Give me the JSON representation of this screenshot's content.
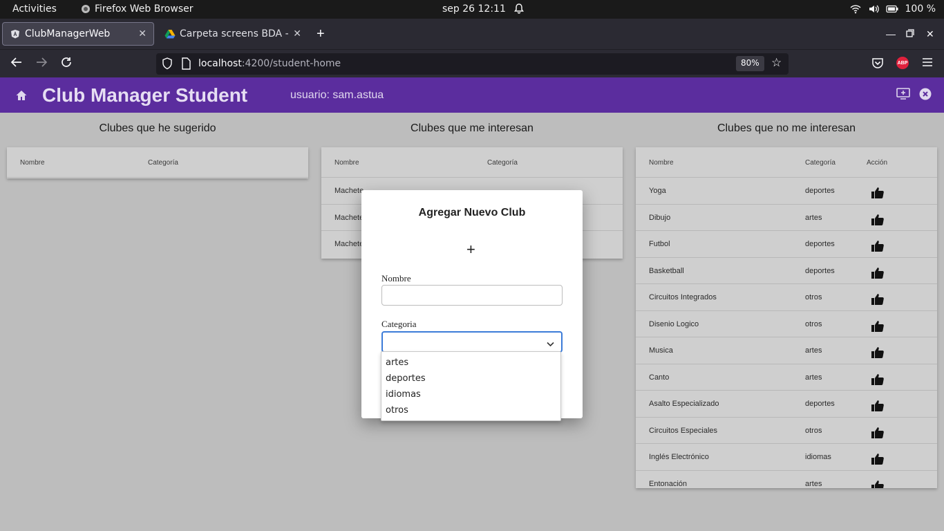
{
  "system": {
    "activities": "Activities",
    "app_name": "Firefox Web Browser",
    "clock": "sep 26  12:11",
    "battery": "100 %"
  },
  "browser": {
    "tabs": [
      {
        "title": "ClubManagerWeb"
      },
      {
        "title": "Carpeta screens BDA - Go"
      }
    ],
    "url_host": "localhost",
    "url_path": ":4200/student-home",
    "zoom": "80%",
    "abp_label": "ABP"
  },
  "app": {
    "title": "Club Manager Student",
    "user_label": "usuario: sam.astua"
  },
  "columns": {
    "suggested": {
      "title": "Clubes que he sugerido",
      "headers": [
        "Nombre",
        "Categoría"
      ]
    },
    "interested": {
      "title": "Clubes que me interesan",
      "headers": [
        "Nombre",
        "Categoría"
      ],
      "rows": [
        {
          "name": "Machete"
        },
        {
          "name": "Machete"
        },
        {
          "name": "Machete"
        }
      ]
    },
    "not_interested": {
      "title": "Clubes que no me interesan",
      "headers": [
        "Nombre",
        "Categoría",
        "Acción"
      ],
      "rows": [
        {
          "name": "Yoga",
          "category": "deportes"
        },
        {
          "name": "Dibujo",
          "category": "artes"
        },
        {
          "name": "Futbol",
          "category": "deportes"
        },
        {
          "name": "Basketball",
          "category": "deportes"
        },
        {
          "name": "Circuitos Integrados",
          "category": "otros"
        },
        {
          "name": "Disenio Logico",
          "category": "otros"
        },
        {
          "name": "Musica",
          "category": "artes"
        },
        {
          "name": "Canto",
          "category": "artes"
        },
        {
          "name": "Asalto Especializado",
          "category": "deportes"
        },
        {
          "name": "Circuitos Especiales",
          "category": "otros"
        },
        {
          "name": "Inglés Electrónico",
          "category": "idiomas"
        },
        {
          "name": "Entonación",
          "category": "artes"
        }
      ]
    }
  },
  "dialog": {
    "title": "Agregar Nuevo Club",
    "add_symbol": "+",
    "name_label": "Nombre",
    "name_value": "",
    "category_label": "Categoria",
    "category_value": "",
    "options": [
      "artes",
      "deportes",
      "idiomas",
      "otros"
    ]
  },
  "colors": {
    "header_bg": "#5b2d9e",
    "page_bg": "#bdbdbd",
    "focus_border": "#3b7bd8"
  }
}
